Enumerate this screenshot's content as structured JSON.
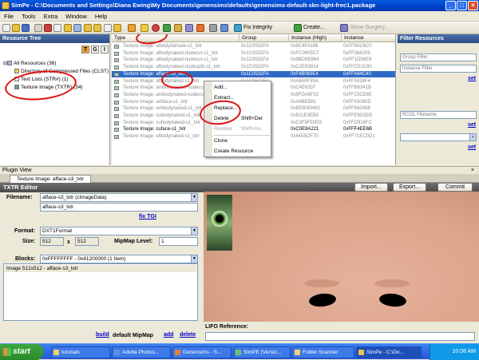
{
  "window": {
    "title": "SimPe - C:\\Documents and Settings\\Diana Ewing\\My Documents\\genensims\\defaults\\genensims-default-skn-light-frec1.package",
    "minimize": "_",
    "maximize": "□",
    "close": "×"
  },
  "menu": [
    "File",
    "Tools",
    "Extra",
    "Window",
    "Help"
  ],
  "toolbar": {
    "fix_integrity": "Fix Integrity",
    "create": "Create...",
    "show_surgery": "Show Surgery..."
  },
  "resource_tree": {
    "title": "Resource Tree",
    "tgi": [
      "T",
      "G",
      "I"
    ],
    "items": [
      "All Resources (36)",
      "Directory of Compressed Files (CLST)",
      "Text Lists (STR#) (1)",
      "Texture Image (TXTR) (34)"
    ]
  },
  "list": {
    "columns": [
      "Type",
      "Group",
      "Instance (High)",
      "Instance"
    ],
    "rows": [
      {
        "type": "Texture Image: afbodyfatmale-s1_txtr",
        "group": "0x1C0532FA",
        "high": "0x9C4F4166",
        "inst": "0xFF85C6C0",
        "style": ""
      },
      {
        "type": "Texture Image: afbodynaked-nudecut-s1_txtr",
        "group": "0x1C0532FA",
        "high": "0xFC0605C7",
        "inst": "0xFF084205",
        "style": ""
      },
      {
        "type": "Texture Image: afbodynaked-nudecut-s1_txtr",
        "group": "0x1C0532FA",
        "high": "0x8BD0E864",
        "inst": "0xFF1D58E9",
        "style": ""
      },
      {
        "type": "Texture Image: afbodynaked-nudesplit-s1_txtr",
        "group": "0x1C0532FA",
        "high": "0xC2E93914",
        "inst": "0xFFC01C80",
        "style": ""
      },
      {
        "type": "Texture Image: afface-s3_txtr",
        "group": "0x1C0532FA",
        "high": "0xF4B083E4",
        "inst": "0xFFA84C40",
        "style": "sel"
      },
      {
        "type": "Texture Image: afbodynaked-s1_txtr",
        "group": "0x1C0532FA",
        "high": "0xA650F35A",
        "inst": "0xFF5924F4",
        "style": ""
      },
      {
        "type": "Texture Image: ambodynaked-nudecut-s1_txtr",
        "group": "0x1C0532FA",
        "high": "0xC4E6337",
        "inst": "0xFFB6341B",
        "style": ""
      },
      {
        "type": "Texture Image: ambodynaked-nudecut-s1_txtr",
        "group": "0x1C0532FA",
        "high": "0x6FDA6F22",
        "inst": "0xFF23CE6E",
        "style": ""
      },
      {
        "type": "Texture Image: amface-s1_txtr",
        "group": "0x1C0532FA",
        "high": "0xA4BEB81",
        "inst": "0xFF43080D",
        "style": ""
      },
      {
        "type": "Texture Image: ambodynaked-s1_txtr",
        "group": "0x1C0532FA",
        "high": "0xB93040461",
        "inst": "0xFF842488",
        "style": ""
      },
      {
        "type": "Texture Image: cubodynaked-s1_txtr",
        "group": "0x1C0532FA",
        "high": "0xB11E0EB5",
        "inst": "0xFFE8D5D5",
        "style": ""
      },
      {
        "type": "Texture Image: cubodynaked-s1_txtr",
        "group": "0x1C0532FA",
        "high": "0xC3F9FD903",
        "inst": "0xFFD918FC",
        "style": ""
      },
      {
        "type": "Texture Image: cuface-s1_txtr",
        "group": "0x1C0532FA",
        "high": "0xC0E9A221",
        "inst": "0xFFF4EE6B",
        "style": "bold"
      },
      {
        "type": "Texture Image: efbodynaked-s1_txtr",
        "group": "0x1C0532FA",
        "high": "0x44EB2F70",
        "inst": "0xFF71EC0D1",
        "style": ""
      }
    ]
  },
  "context_menu": {
    "add": "Add...",
    "extract": "Extract...",
    "replace": "Replace...",
    "delete": "Delete",
    "delete_shortcut": "Shift+Del",
    "restore": "Restore",
    "restore_shortcut": "Shift+Ins",
    "clone": "Clone",
    "create_resource": "Create Resource"
  },
  "filter_panel": {
    "title": "Filter Resources",
    "group_placeholder": "Group Filter",
    "instance_placeholder": "Instance Filter",
    "rcol_placeholder": "RCOL Filename",
    "set": "set"
  },
  "plugin_view": {
    "title": "Plugin View",
    "tab": "Texture Image: afface-s3_txtr"
  },
  "txtr_editor": {
    "title": "TXTR Editor",
    "import": "Import...",
    "export": "Export...",
    "commit": "Commit",
    "filename_label": "Filename:",
    "filename_value": "afface-s3_txtr (cImageData)",
    "filename2": "afface-s3_txtr",
    "fix_tgi": "fix TGI",
    "format_label": "Format:",
    "format_value": "DXT1Format",
    "size_label": "Size:",
    "width": "512",
    "x": "x",
    "height": "512",
    "mipmap_label": "MipMap Level:",
    "mipmap_value": "1",
    "blocks_label": "Blocks:",
    "blocks_value": "0xFFFFFFFF - 0x41200000 (1 Item)",
    "image_item": "Image 512x512 - afface-s3_txtr",
    "build": "build",
    "default_mipmap": "default MipMap",
    "add": "add",
    "delete": "delete",
    "lifo_label": "LIFO Reference:"
  },
  "taskbar": {
    "start": "start",
    "items": [
      "tutorials",
      "Adobe Photos...",
      "Genensims - S...",
      "SimPE (Versio...",
      "Folder Scanner",
      "SimPe - C:\\Do..."
    ],
    "time": "10:08 AM"
  },
  "colors": {
    "selection": "#316ac5",
    "annotation": "#e01010",
    "skin": "#dca58c"
  }
}
